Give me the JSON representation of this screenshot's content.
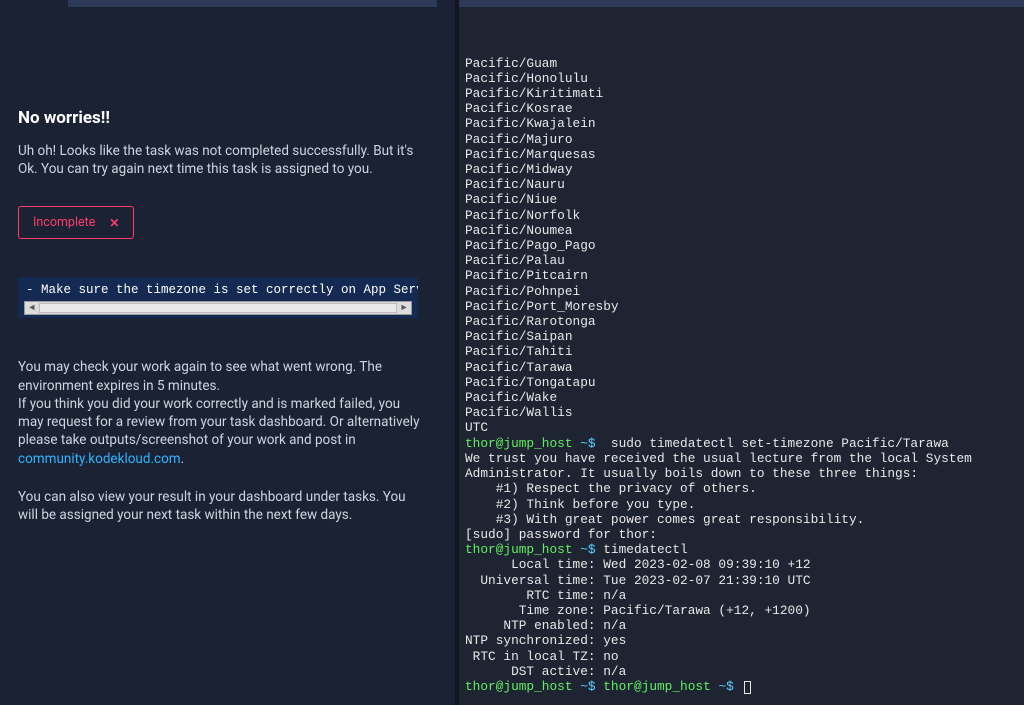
{
  "left": {
    "title": "No worries!!",
    "subtitle": "Uh oh! Looks like the task was not completed successfully. But it's Ok. You can try again next time this task is assigned to you.",
    "status_label": "Incomplete",
    "error_line": "- Make sure the timezone is set correctly on App Server",
    "para1_a": "You may check your work again to see what went wrong. The environment expires in 5 minutes.",
    "para1_b": "If you think you did your work correctly and is marked failed, you may request for a review from your task dashboard. Or alternatively please take outputs/screenshot of your work and post in ",
    "community_link": "community.kodekloud.com",
    "period": ".",
    "para2": "You can also view your result in your dashboard under tasks. You will be assigned your next task within the next few days."
  },
  "terminal": {
    "tz_list": [
      "Pacific/Guam",
      "Pacific/Honolulu",
      "Pacific/Kiritimati",
      "Pacific/Kosrae",
      "Pacific/Kwajalein",
      "Pacific/Majuro",
      "Pacific/Marquesas",
      "Pacific/Midway",
      "Pacific/Nauru",
      "Pacific/Niue",
      "Pacific/Norfolk",
      "Pacific/Noumea",
      "Pacific/Pago_Pago",
      "Pacific/Palau",
      "Pacific/Pitcairn",
      "Pacific/Pohnpei",
      "Pacific/Port_Moresby",
      "Pacific/Rarotonga",
      "Pacific/Saipan",
      "Pacific/Tahiti",
      "Pacific/Tarawa",
      "Pacific/Tongatapu",
      "Pacific/Wake",
      "Pacific/Wallis",
      "UTC"
    ],
    "prompt_user": "thor@jump_host",
    "prompt_path": "~$",
    "cmd1": " sudo timedatectl set-timezone Pacific/Tarawa",
    "lecture1": "We trust you have received the usual lecture from the local System",
    "lecture2": "Administrator. It usually boils down to these three things:",
    "rule1": "    #1) Respect the privacy of others.",
    "rule2": "    #2) Think before you type.",
    "rule3": "    #3) With great power comes great responsibility.",
    "sudo_prompt": "[sudo] password for thor:",
    "cmd2": "timedatectl",
    "out1": "      Local time: Wed 2023-02-08 09:39:10 +12",
    "out2": "  Universal time: Tue 2023-02-07 21:39:10 UTC",
    "out3": "        RTC time: n/a",
    "out4": "       Time zone: Pacific/Tarawa (+12, +1200)",
    "out5": "     NTP enabled: n/a",
    "out6": "NTP synchronized: yes",
    "out7": " RTC in local TZ: no",
    "out8": "      DST active: n/a"
  }
}
